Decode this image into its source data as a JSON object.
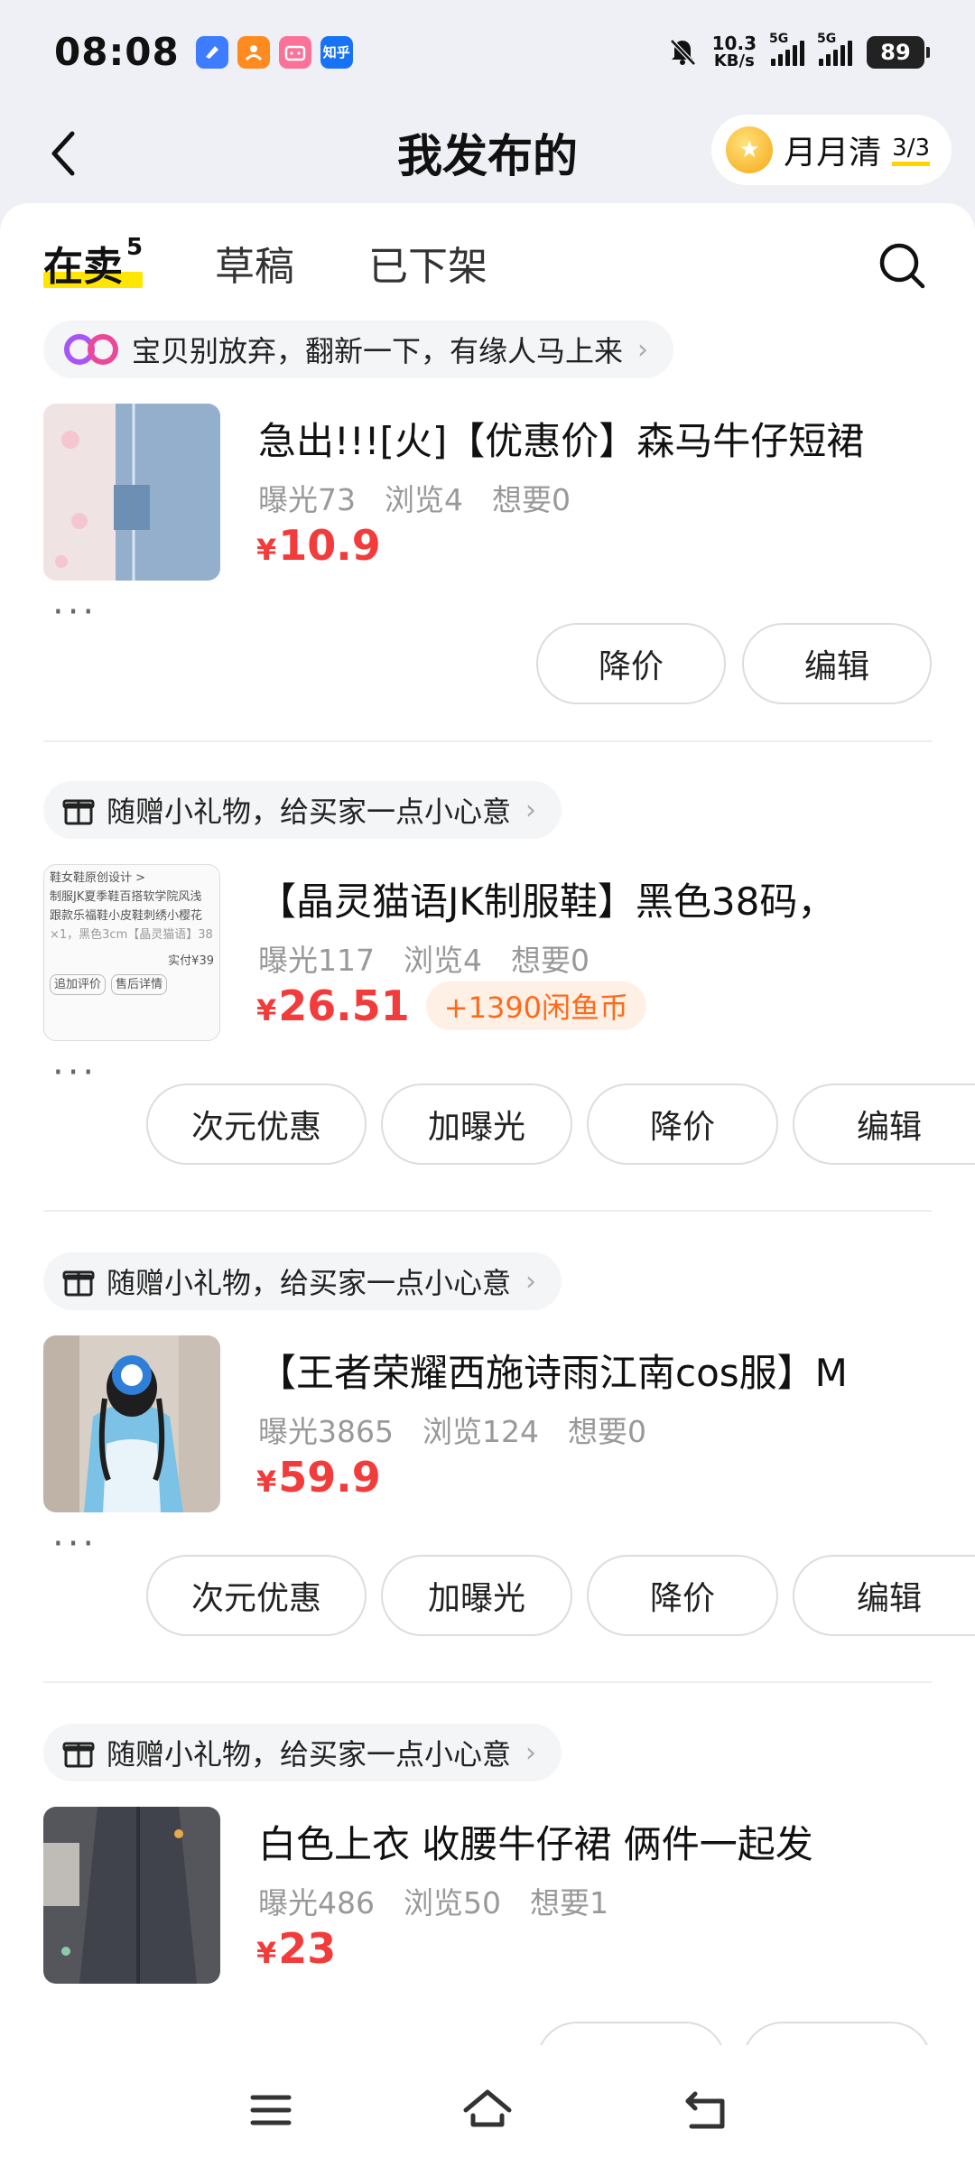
{
  "status_bar": {
    "time": "08:08",
    "net_speed_value": "10.3",
    "net_speed_unit": "KB/s",
    "signal_1": "5G",
    "signal_2": "5G",
    "battery": "89",
    "apps": [
      {
        "name": "blue-app",
        "color": "#3d7bff"
      },
      {
        "name": "orange-app",
        "color": "#ff8a1f"
      },
      {
        "name": "bilibili",
        "color": "#fb7299"
      },
      {
        "name": "zhihu",
        "color": "#1772f6",
        "label": "知乎"
      }
    ]
  },
  "header": {
    "title": "我发布的",
    "monthly_label": "月月清",
    "monthly_count": "3/3"
  },
  "tabs": [
    {
      "label": "在卖",
      "count": "5"
    },
    {
      "label": "草稿"
    },
    {
      "label": "已下架"
    }
  ],
  "items": [
    {
      "tip": "宝贝别放弃，翻新一下，有缘人马上来",
      "title": "急出!!![火]【优惠价】森马牛仔短裙",
      "stats": [
        "曝光73",
        "浏览4",
        "想要0"
      ],
      "currency": "¥",
      "price": "10.9",
      "buttons": [
        "降价",
        "编辑"
      ]
    },
    {
      "tip": "随赠小礼物，给买家一点小心意",
      "title": "【晶灵猫语JK制服鞋】黑色38码，",
      "stats": [
        "曝光117",
        "浏览4",
        "想要0"
      ],
      "currency": "¥",
      "price": "26.51",
      "coins": "+1390闲鱼币",
      "buttons": [
        "次元优惠",
        "加曝光",
        "降价",
        "编辑"
      ],
      "thumb_lines": [
        "鞋女鞋原创设计 >",
        "制服JK夏季鞋百搭软学院风浅",
        "跟款乐福鞋小皮鞋刺绣小樱花",
        "×1，黑色3cm【晶灵猫语】38",
        "实付¥39",
        "追加评价",
        "售后详情"
      ]
    },
    {
      "tip": "随赠小礼物，给买家一点小心意",
      "title": "【王者荣耀西施诗雨江南cos服】M",
      "stats": [
        "曝光3865",
        "浏览124",
        "想要0"
      ],
      "currency": "¥",
      "price": "59.9",
      "buttons": [
        "次元优惠",
        "加曝光",
        "降价",
        "编辑"
      ]
    },
    {
      "tip": "随赠小礼物，给买家一点小心意",
      "title": "白色上衣 收腰牛仔裙 俩件一起发",
      "stats": [
        "曝光486",
        "浏览50",
        "想要1"
      ],
      "currency": "¥",
      "price": "23"
    }
  ],
  "more_label": "···",
  "colors": {
    "accent_yellow": "#ffe600",
    "price_red": "#f23c3c",
    "coin_orange": "#ff6a1a"
  }
}
